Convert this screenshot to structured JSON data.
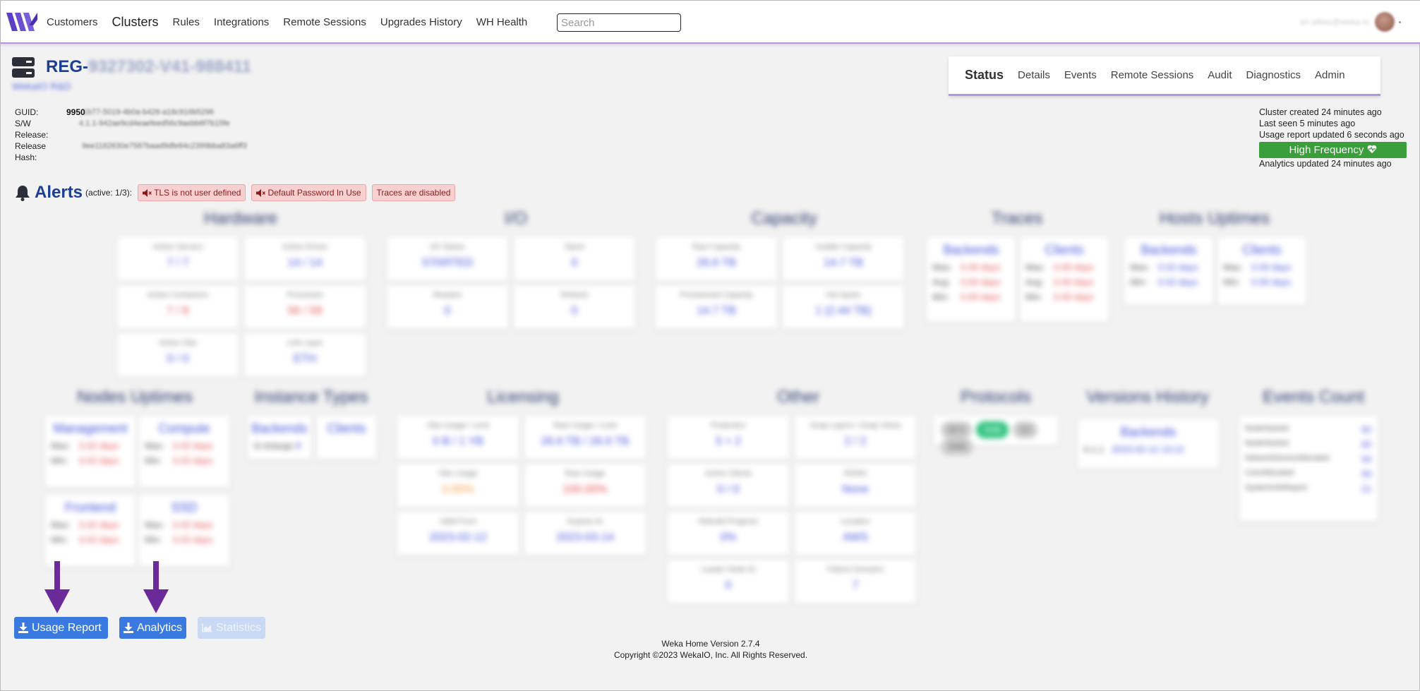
{
  "nav": {
    "items": [
      "Customers",
      "Clusters",
      "Rules",
      "Integrations",
      "Remote Sessions",
      "Upgrades History",
      "WH Health"
    ],
    "active": "Clusters",
    "search_placeholder": "Search",
    "user_email": "ari.attias@weka.io"
  },
  "cluster": {
    "name_prefix": "REG-",
    "name_hidden": "9327302-V41-988411",
    "org": "WekaIO R&D",
    "guid_label": "GUID:",
    "guid_visible": "9950",
    "guid_hidden": "1b77-5019-4b0a-b426-a18c916b5296",
    "sw_label": "S/W Release:",
    "sw_value": "4.1.1-942ae9cd4eaefeed56c9aebb6f7b15fe",
    "hash_label": "Release Hash:",
    "hash_value": "9ee1182630e7587baad9dfe84c2399bba83a6ff3"
  },
  "tabs": [
    "Status",
    "Details",
    "Events",
    "Remote Sessions",
    "Audit",
    "Diagnostics",
    "Admin"
  ],
  "status_info": {
    "created": "Cluster created 24 minutes ago",
    "last_seen": "Last seen 5 minutes ago",
    "usage_report": "Usage report updated 6 seconds ago",
    "badge": "High Frequency",
    "analytics": "Analytics updated 24 minutes ago"
  },
  "alerts": {
    "title": "Alerts",
    "active": "(active: 1/3):",
    "pills": [
      "TLS is not user defined",
      "Default Password In Use",
      "Traces are disabled"
    ]
  },
  "sections": {
    "hardware": {
      "title": "Hardware",
      "cards": [
        {
          "label": "Active Servers",
          "value": "7 / 7"
        },
        {
          "label": "Active Drives",
          "value": "14 / 14"
        },
        {
          "label": "Active Containers",
          "value": "7 / 8"
        },
        {
          "label": "Processes",
          "value": "56 / 58"
        },
        {
          "label": "Active Obs",
          "value": "0 / 0"
        },
        {
          "label": "Link Layer",
          "value": "ETH"
        }
      ]
    },
    "io": {
      "title": "I/O",
      "cards": [
        {
          "label": "I/O Status",
          "value": "STARTED"
        },
        {
          "label": "Ops/s",
          "value": "0"
        },
        {
          "label": "Reads/s",
          "value": "0"
        },
        {
          "label": "Writes/s",
          "value": "0"
        }
      ]
    },
    "capacity": {
      "title": "Capacity",
      "cards": [
        {
          "label": "Raw Capacity",
          "value": "26.6 TB"
        },
        {
          "label": "Usable Capacity",
          "value": "14.7 TB"
        },
        {
          "label": "Provisioned Capacity",
          "value": "14.7 TB"
        },
        {
          "label": "Hot Spare",
          "value": "1 (2.44 TB)"
        }
      ]
    },
    "traces": {
      "title": "Traces",
      "backends": "Backends",
      "clients": "Clients",
      "rows": [
        {
          "k": "Max:",
          "v": "0.00 days"
        },
        {
          "k": "Avg:",
          "v": "0.00 days"
        },
        {
          "k": "Min:",
          "v": "0.00 days"
        }
      ]
    },
    "hosts": {
      "title": "Hosts Uptimes",
      "backends": "Backends",
      "clients": "Clients",
      "rows": [
        {
          "k": "Max:",
          "v": "0.02 days"
        },
        {
          "k": "Min:",
          "v": "0.02 days"
        }
      ],
      "client_rows": [
        {
          "k": "Max:",
          "v": "0.00 days"
        },
        {
          "k": "Min:",
          "v": "0.00 days"
        }
      ]
    },
    "nodes": {
      "title": "Nodes Uptimes",
      "groups": [
        {
          "name": "Management",
          "rows": [
            {
              "k": "Max:",
              "v": "0.02 days"
            },
            {
              "k": "Min:",
              "v": "0.02 days"
            }
          ]
        },
        {
          "name": "Compute",
          "rows": [
            {
              "k": "Max:",
              "v": "0.02 days"
            },
            {
              "k": "Min:",
              "v": "0.02 days"
            }
          ]
        },
        {
          "name": "Frontend",
          "rows": [
            {
              "k": "Max:",
              "v": "0.02 days"
            },
            {
              "k": "Min:",
              "v": "0.02 days"
            }
          ]
        },
        {
          "name": "SSD",
          "rows": [
            {
              "k": "Max:",
              "v": "0.02 days"
            },
            {
              "k": "Min:",
              "v": "0.02 days"
            }
          ]
        }
      ]
    },
    "instance": {
      "title": "Instance Types",
      "backends": "Backends",
      "clients": "Clients",
      "row": "i3.4xlarge",
      "count": "8"
    },
    "licensing": {
      "title": "Licensing",
      "cards": [
        {
          "label": "Obs Usage / Limit",
          "value": "0 B / 1 YB"
        },
        {
          "label": "Raw Usage / Limit",
          "value": "26.6 TB / 26.6 TB"
        },
        {
          "label": "Obs Usage",
          "value": "0.00%"
        },
        {
          "label": "Raw Usage",
          "value": "100.00%"
        },
        {
          "label": "Valid From",
          "value": "2023-02-12"
        },
        {
          "label": "Expires At",
          "value": "2023-03-14"
        }
      ]
    },
    "other": {
      "title": "Other",
      "cards": [
        {
          "label": "Protection",
          "value": "5 + 2"
        },
        {
          "label": "Snap Layers / Snap Views",
          "value": "2 / 2"
        },
        {
          "label": "Active Clients",
          "value": "0 / 0"
        },
        {
          "label": "RDMA",
          "value": "None"
        },
        {
          "label": "Rebuild Progress",
          "value": "0%"
        },
        {
          "label": "Location",
          "value": "AWS"
        },
        {
          "label": "Leader Node ID",
          "value": "0"
        },
        {
          "label": "Failure Domains",
          "value": "7"
        }
      ]
    },
    "protocols": {
      "title": "Protocols",
      "chips": [
        "NFS",
        "SMB",
        "S3",
        "SMB"
      ]
    },
    "versions": {
      "title": "Versions History",
      "backends": "Backends",
      "version": "4.1.1",
      "date": "2023-02-12 13:12"
    },
    "events": {
      "title": "Events Count",
      "rows": [
        {
          "k": "NodeStarted",
          "v": "92"
        },
        {
          "k": "NodeStarted",
          "v": "82"
        },
        {
          "k": "NetworkDeviceAllocated",
          "v": "50"
        },
        {
          "k": "CoreAllocated",
          "v": "50"
        },
        {
          "k": "SystemInfoReport",
          "v": "21"
        }
      ]
    }
  },
  "buttons": {
    "usage": "Usage Report",
    "analytics": "Analytics",
    "statistics": "Statistics"
  },
  "footer": {
    "version": "Weka Home Version 2.7.4",
    "copyright": "Copyright ©2023 WekaIO, Inc. All Rights Reserved."
  },
  "colors": {
    "brand": "#1c3f94",
    "accent": "#b992e0",
    "button": "#3a7ae0",
    "badge": "#3a9e3a",
    "arrow": "#6a2a9a"
  }
}
